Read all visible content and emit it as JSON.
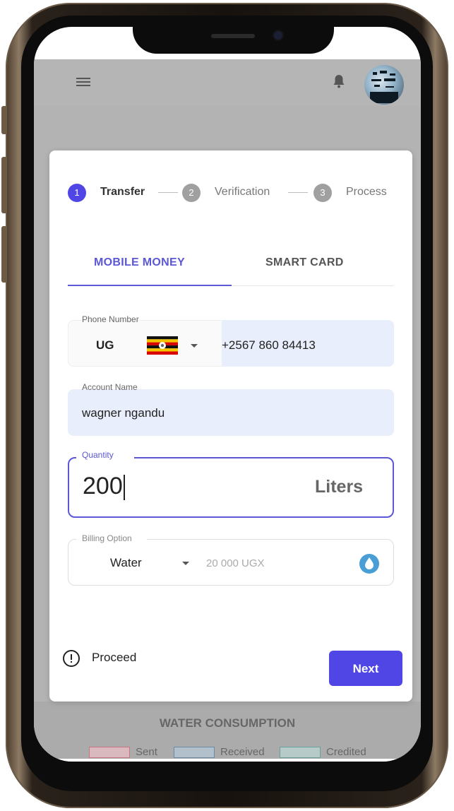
{
  "stepper": {
    "steps": [
      {
        "number": "1",
        "label": "Transfer"
      },
      {
        "number": "2",
        "label": "Verification"
      },
      {
        "number": "3",
        "label": "Process"
      }
    ],
    "active_color": "#4f46e5",
    "inactive_color": "#a0a0a0"
  },
  "tabs": [
    {
      "label": "MOBILE MONEY"
    },
    {
      "label": "SMART CARD"
    }
  ],
  "phone": {
    "label": "Phone Number",
    "country_code": "UG",
    "value": "+2567 860 84413"
  },
  "account": {
    "label": "Account Name",
    "value": "wagner ngandu"
  },
  "quantity": {
    "label": "Quantity",
    "value": "200",
    "unit": "Liters"
  },
  "billing": {
    "label": "Billing Option",
    "selected": "Water",
    "amount": "20 000 UGX"
  },
  "footer": {
    "proceed_label": "Proceed",
    "next_label": "Next"
  },
  "consumption": {
    "title": "WATER CONSUMPTION",
    "legend": [
      {
        "label": "Sent",
        "color": "#d96b7b",
        "fill": "#f3c6cd"
      },
      {
        "label": "Received",
        "color": "#5b86a8",
        "fill": "#bcd0e0"
      },
      {
        "label": "Credited",
        "color": "#5ba3a0",
        "fill": "#c2dedc"
      }
    ]
  },
  "colors": {
    "accent": "#4f46e5",
    "field_bg": "#e8eefb",
    "water_drop": "#4a9ed6"
  }
}
